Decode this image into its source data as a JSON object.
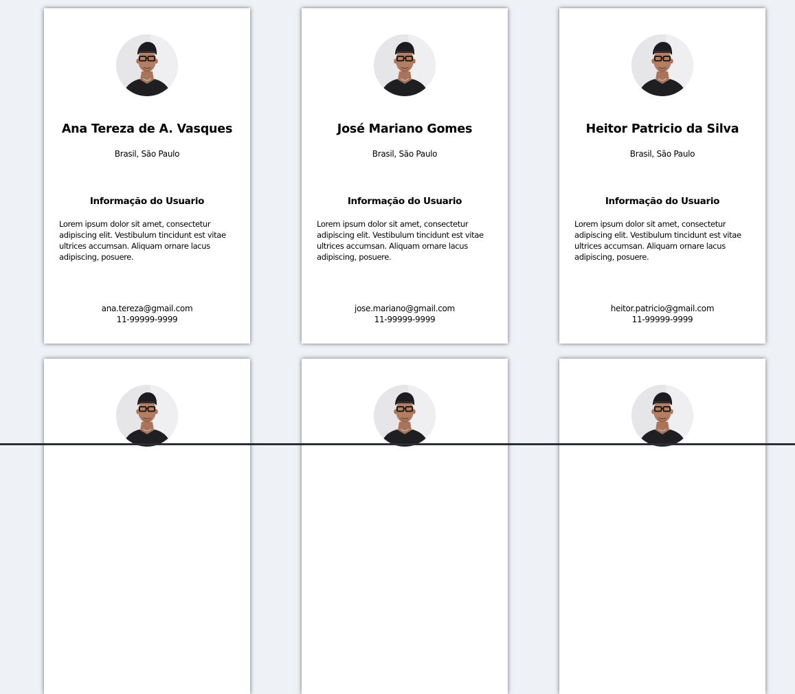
{
  "info_title": "Informação do Usuario",
  "cards": [
    {
      "name": "Ana Tereza de A. Vasques",
      "location": "Brasil, São Paulo",
      "info_text": "Lorem ipsum dolor sit amet, consectetur adipiscing elit. Vestibulum tincidunt est vitae ultrices accumsan. Aliquam ornare lacus adipiscing, posuere.",
      "email": "ana.tereza@gmail.com",
      "phone": "11-99999-9999"
    },
    {
      "name": "José Mariano Gomes",
      "location": "Brasil, São Paulo",
      "info_text": "Lorem ipsum dolor sit amet, consectetur adipiscing elit. Vestibulum tincidunt est vitae ultrices accumsan. Aliquam ornare lacus adipiscing, posuere.",
      "email": "jose.mariano@gmail.com",
      "phone": "11-99999-9999"
    },
    {
      "name": "Heitor Patricio da Silva",
      "location": "Brasil, São Paulo",
      "info_text": "Lorem ipsum dolor sit amet, consectetur adipiscing elit. Vestibulum tincidunt est vitae ultrices accumsan. Aliquam ornare lacus adipiscing, posuere.",
      "email": "heitor.patricio@gmail.com",
      "phone": "11-99999-9999"
    }
  ],
  "colors": {
    "background": "#eef2f6",
    "card": "#ffffff",
    "text": "#000000"
  }
}
